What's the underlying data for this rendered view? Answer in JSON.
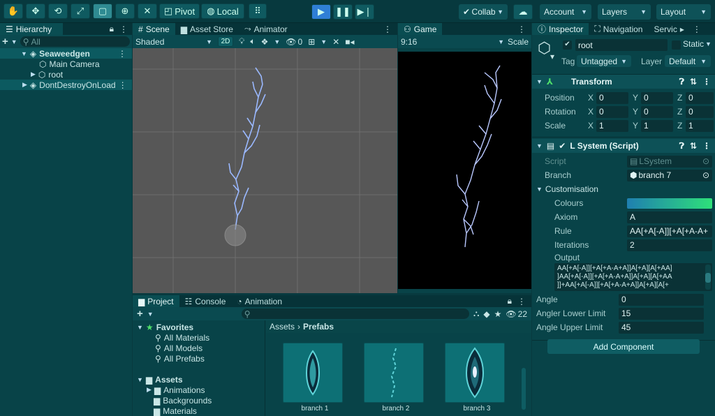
{
  "toolbar": {
    "pivot_label": "Pivot",
    "local_label": "Local",
    "collab_label": "Collab",
    "account_label": "Account",
    "layers_label": "Layers",
    "layout_label": "Layout"
  },
  "hierarchy": {
    "tab_label": "Hierarchy",
    "search_placeholder": "All",
    "items": [
      {
        "label": "Seaweedgen"
      },
      {
        "label": "Main Camera"
      },
      {
        "label": "root"
      },
      {
        "label": "DontDestroyOnLoad"
      }
    ]
  },
  "scene": {
    "tabs": [
      {
        "label": "Scene"
      },
      {
        "label": "Asset Store"
      },
      {
        "label": "Animator"
      }
    ],
    "shading": "Shaded",
    "mode_2d": "2D",
    "hidden_count": "0"
  },
  "game": {
    "tab_label": "Game",
    "aspect": "9:16",
    "scale_label": "Scale"
  },
  "project": {
    "tabs": [
      {
        "label": "Project"
      },
      {
        "label": "Console"
      },
      {
        "label": "Animation"
      }
    ],
    "badge_count": "22",
    "tree": {
      "favorites_label": "Favorites",
      "favorites": [
        {
          "label": "All Materials"
        },
        {
          "label": "All Models"
        },
        {
          "label": "All Prefabs"
        }
      ],
      "assets_label": "Assets",
      "folders": [
        {
          "label": "Animations"
        },
        {
          "label": "Backgrounds"
        },
        {
          "label": "Materials"
        }
      ]
    },
    "breadcrumb": {
      "root": "Assets",
      "current": "Prefabs"
    },
    "assets": [
      {
        "label": "branch 1"
      },
      {
        "label": "branch 2"
      },
      {
        "label": "branch 3"
      }
    ]
  },
  "inspector": {
    "tabs": [
      {
        "label": "Inspector"
      },
      {
        "label": "Navigation"
      },
      {
        "label": "Servic"
      }
    ],
    "object_name": "root",
    "static_label": "Static",
    "tag_label": "Tag",
    "tag_value": "Untagged",
    "layer_label": "Layer",
    "layer_value": "Default",
    "transform": {
      "title": "Transform",
      "position_label": "Position",
      "rotation_label": "Rotation",
      "scale_label": "Scale",
      "axis_x": "X",
      "axis_y": "Y",
      "axis_z": "Z",
      "position": [
        "0",
        "0",
        "0"
      ],
      "rotation": [
        "0",
        "0",
        "0"
      ],
      "scale": [
        "1",
        "1",
        "1"
      ]
    },
    "lsystem": {
      "title": "L System (Script)",
      "script_label": "Script",
      "script_value": "LSystem",
      "branch_label": "Branch",
      "branch_value": "branch 7",
      "customisation_label": "Customisation",
      "colours_label": "Colours",
      "axiom_label": "Axiom",
      "axiom_value": "A",
      "rule_label": "Rule",
      "rule_value": "AA[+A[-A]][+A[+A-A+",
      "iterations_label": "Iterations",
      "iterations_value": "2",
      "output_label": "Output",
      "output_lines": [
        "AA[+A[-A]][+A[+A-A+A]]A[+A][A[+AA]",
        "]AA[+A[-A]][+A[+A-A+A]]A[+A][A[+AA",
        "]]+AA[+A[-A]][+A[+A-A+A]]A[+A][A[+"
      ],
      "angle_label": "Angle",
      "angle_value": "0",
      "lower_label": "Angler Lower Limit",
      "lower_value": "15",
      "upper_label": "Angle Upper Limit",
      "upper_value": "45"
    },
    "add_component_label": "Add Component"
  },
  "colors": {
    "accent": "#2f7fd6",
    "panel": "#084348",
    "gradient_start": "#1f7fb0",
    "gradient_end": "#2ee07a"
  }
}
